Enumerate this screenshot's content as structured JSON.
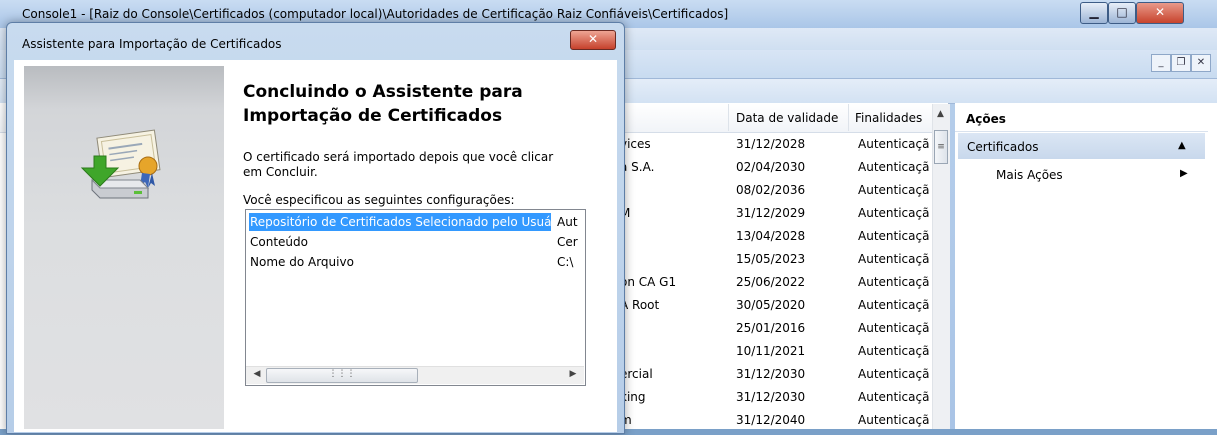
{
  "mmc": {
    "title": "Console1 - [Raiz do Console\\Certificados (computador local)\\Autoridades de Certificação Raiz Confiáveis\\Certificados]",
    "columns": [
      "Data de validade",
      "Finalidades"
    ],
    "rows": [
      {
        "name": "vices",
        "date": "31/12/2028",
        "purpose": "Autenticaçã"
      },
      {
        "name": "a S.A.",
        "date": "02/04/2030",
        "purpose": "Autenticaçã"
      },
      {
        "name": "",
        "date": "08/02/2036",
        "purpose": "Autenticaçã"
      },
      {
        "name": "M",
        "date": "31/12/2029",
        "purpose": "Autenticaçã"
      },
      {
        "name": "",
        "date": "13/04/2028",
        "purpose": "Autenticaçã"
      },
      {
        "name": "",
        "date": "15/05/2023",
        "purpose": "Autenticaçã"
      },
      {
        "name": "on CA G1",
        "date": "25/06/2022",
        "purpose": "Autenticaçã"
      },
      {
        "name": "A Root",
        "date": "30/05/2020",
        "purpose": "Autenticaçã"
      },
      {
        "name": "",
        "date": "25/01/2016",
        "purpose": "Autenticaçã"
      },
      {
        "name": "",
        "date": "10/11/2021",
        "purpose": "Autenticaçã"
      },
      {
        "name": "ercial",
        "date": "31/12/2030",
        "purpose": "Autenticaçã"
      },
      {
        "name": "king",
        "date": "31/12/2030",
        "purpose": "Autenticaçã"
      },
      {
        "name": "m",
        "date": "31/12/2040",
        "purpose": "Autenticaçã"
      }
    ],
    "actions": {
      "title": "Ações",
      "section": "Certificados",
      "more": "Mais Ações"
    }
  },
  "wizard": {
    "title": "Assistente para Importação de Certificados",
    "heading": "Concluindo o Assistente para Importação de Certificados",
    "description": "O certificado será importado depois que você clicar em Concluir.",
    "settings_label": "Você especificou as seguintes configurações:",
    "settings": [
      {
        "key": "Repositório de Certificados Selecionado pelo Usuário",
        "value": "Aut"
      },
      {
        "key": "Conteúdo",
        "value": "Cer"
      },
      {
        "key": "Nome do Arquivo",
        "value": "C:\\"
      }
    ]
  },
  "icons": {
    "window_close": "close-icon",
    "certificate_import": "certificate-import-icon"
  }
}
